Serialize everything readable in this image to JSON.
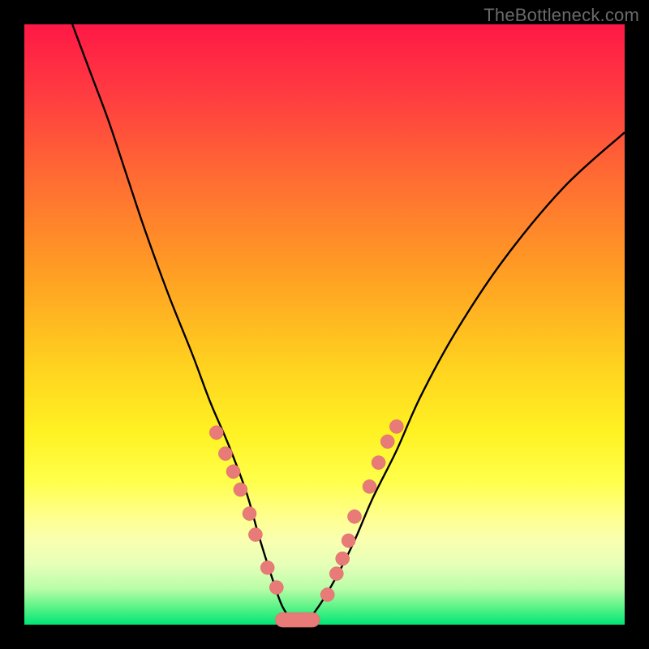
{
  "watermark": "TheBottleneck.com",
  "colors": {
    "frame": "#000000",
    "curve": "#000000",
    "marker_fill": "#e87a78",
    "marker_stroke": "#d96a66",
    "gradient_top": "#ff1846",
    "gradient_bottom": "#00e676"
  },
  "chart_data": {
    "type": "line",
    "title": "",
    "xlabel": "",
    "ylabel": "",
    "xlim": [
      0,
      100
    ],
    "ylim": [
      0,
      100
    ],
    "grid": false,
    "series": [
      {
        "name": "bottleneck_curve",
        "x": [
          8,
          11,
          14,
          17,
          20,
          24,
          28,
          31,
          34,
          37,
          39,
          41.2,
          43,
          44.8,
          47,
          49,
          52,
          55,
          58,
          62,
          66,
          72,
          80,
          90,
          100
        ],
        "values": [
          100,
          92,
          84,
          75,
          66,
          55,
          45,
          37,
          30,
          22,
          15,
          8,
          3,
          0.8,
          0.8,
          3,
          8,
          14,
          21,
          29,
          38,
          49,
          61,
          73,
          82
        ]
      }
    ],
    "valley_flat": {
      "x_start": 43.0,
      "x_end": 48.0,
      "y": 0.8
    },
    "markers": {
      "left_branch": [
        [
          32.0,
          32.0
        ],
        [
          33.5,
          28.5
        ],
        [
          34.8,
          25.5
        ],
        [
          36.0,
          22.5
        ],
        [
          37.5,
          18.5
        ],
        [
          38.5,
          15.0
        ],
        [
          40.5,
          9.5
        ],
        [
          42.0,
          6.2
        ]
      ],
      "right_branch": [
        [
          50.5,
          5.0
        ],
        [
          52.0,
          8.5
        ],
        [
          53.0,
          11.0
        ],
        [
          54.0,
          14.0
        ],
        [
          55.0,
          18.0
        ],
        [
          57.5,
          23.0
        ],
        [
          59.0,
          27.0
        ],
        [
          60.5,
          30.5
        ],
        [
          62.0,
          33.0
        ]
      ],
      "valley": "flat_segment_as_marker_band"
    }
  }
}
